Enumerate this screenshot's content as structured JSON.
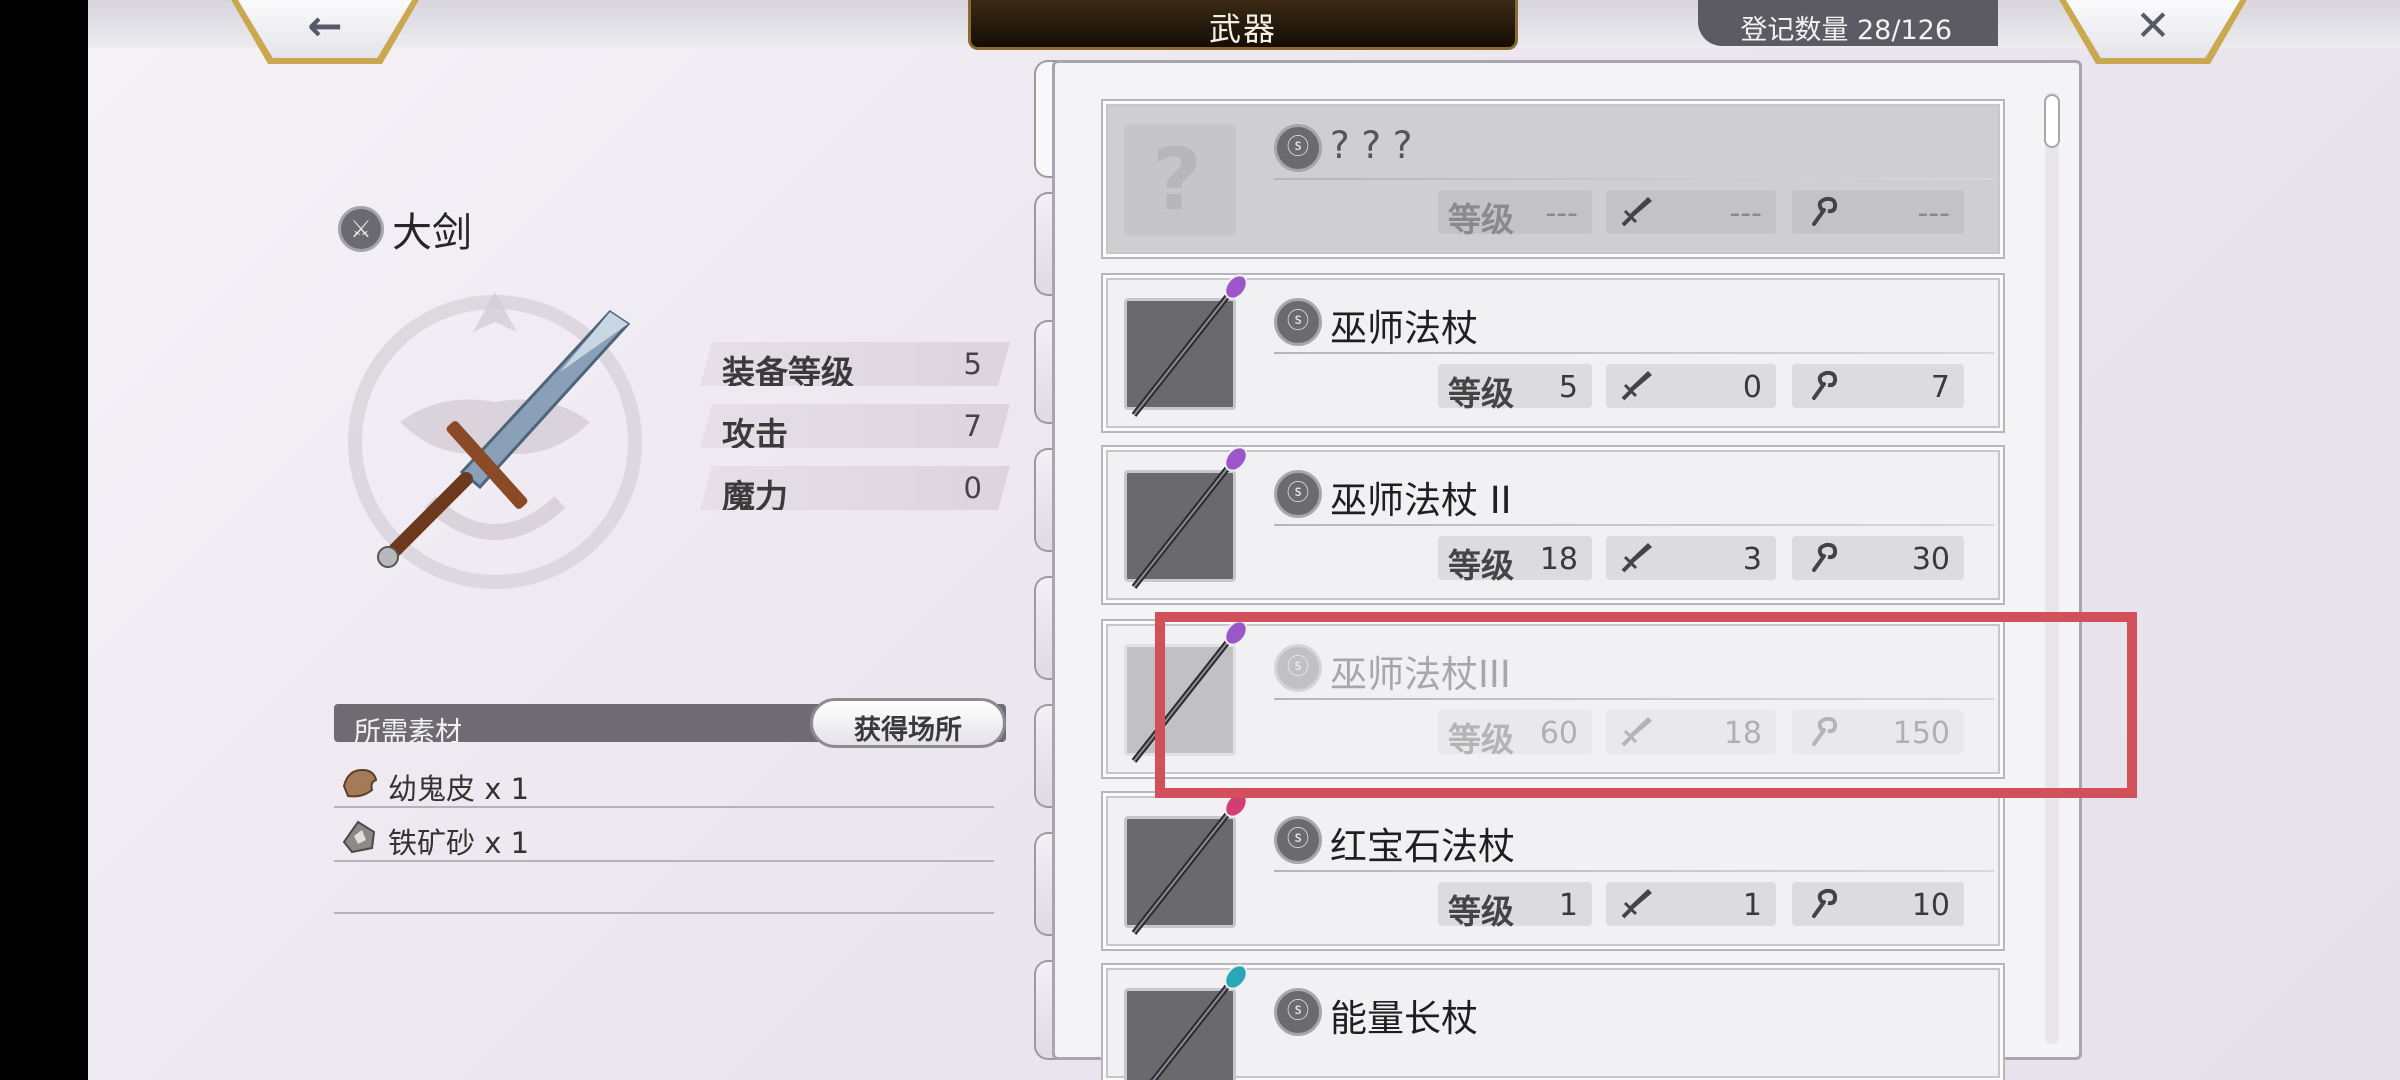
{
  "header": {
    "back_glyph": "←",
    "close_glyph": "✕",
    "title": "武器",
    "count_label": "登记数量 28/126"
  },
  "detail": {
    "weapon_name": "大剑",
    "stats": [
      {
        "label": "装备等级",
        "value": "5"
      },
      {
        "label": "攻击",
        "value": "7"
      },
      {
        "label": "魔力",
        "value": "0"
      }
    ],
    "materials_label": "所需素材",
    "get_location_label": "获得场所",
    "materials": [
      {
        "name": "幼鬼皮 x 1",
        "icon": "hide-icon"
      },
      {
        "name": "铁矿砂 x 1",
        "icon": "ore-icon"
      }
    ]
  },
  "tabs": [
    "staff-icon",
    "sword-icon",
    "blade-icon",
    "axe-icon",
    "spear-icon",
    "bow-icon",
    "gauntlet-icon",
    "hammer-icon"
  ],
  "list": {
    "level_label": "等级",
    "items": [
      {
        "name": "? ? ?",
        "level": "---",
        "atk": "---",
        "mag": "---",
        "state": "locked"
      },
      {
        "name": "巫师法杖",
        "level": "5",
        "atk": "0",
        "mag": "7",
        "state": "normal"
      },
      {
        "name": "巫师法杖 II",
        "level": "18",
        "atk": "3",
        "mag": "30",
        "state": "normal"
      },
      {
        "name": "巫师法杖III",
        "level": "60",
        "atk": "18",
        "mag": "150",
        "state": "faded"
      },
      {
        "name": "红宝石法杖",
        "level": "1",
        "atk": "1",
        "mag": "10",
        "state": "normal"
      },
      {
        "name": "能量长杖",
        "level": "",
        "atk": "",
        "mag": "",
        "state": "normal"
      }
    ]
  },
  "colors": {
    "highlight": "#d2505a",
    "gold_border": "#c9a850"
  }
}
